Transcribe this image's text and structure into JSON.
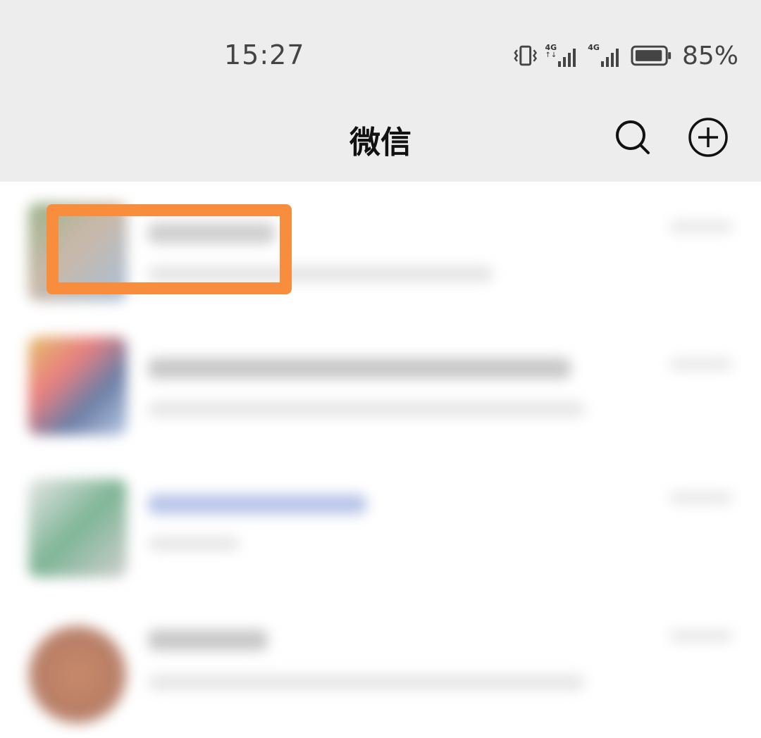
{
  "status_bar": {
    "time": "15:27",
    "network_1": "4G",
    "network_2": "4G",
    "battery_percent": "85%",
    "icons": [
      "vibrate-icon",
      "signal-4g-icon",
      "signal-4g-icon",
      "battery-icon"
    ]
  },
  "header": {
    "title": "微信",
    "actions": [
      "search-icon",
      "add-circle-icon"
    ]
  },
  "chat_list": {
    "note": "",
    "items": [
      {
        "blurred": true,
        "highlighted": true
      },
      {
        "blurred": true,
        "highlighted": false
      },
      {
        "blurred": true,
        "highlighted": false
      },
      {
        "blurred": true,
        "highlighted": false
      }
    ]
  },
  "colors": {
    "header_bg": "#ededed",
    "highlight": "#f88d3d",
    "list_bg": "#ffffff"
  }
}
